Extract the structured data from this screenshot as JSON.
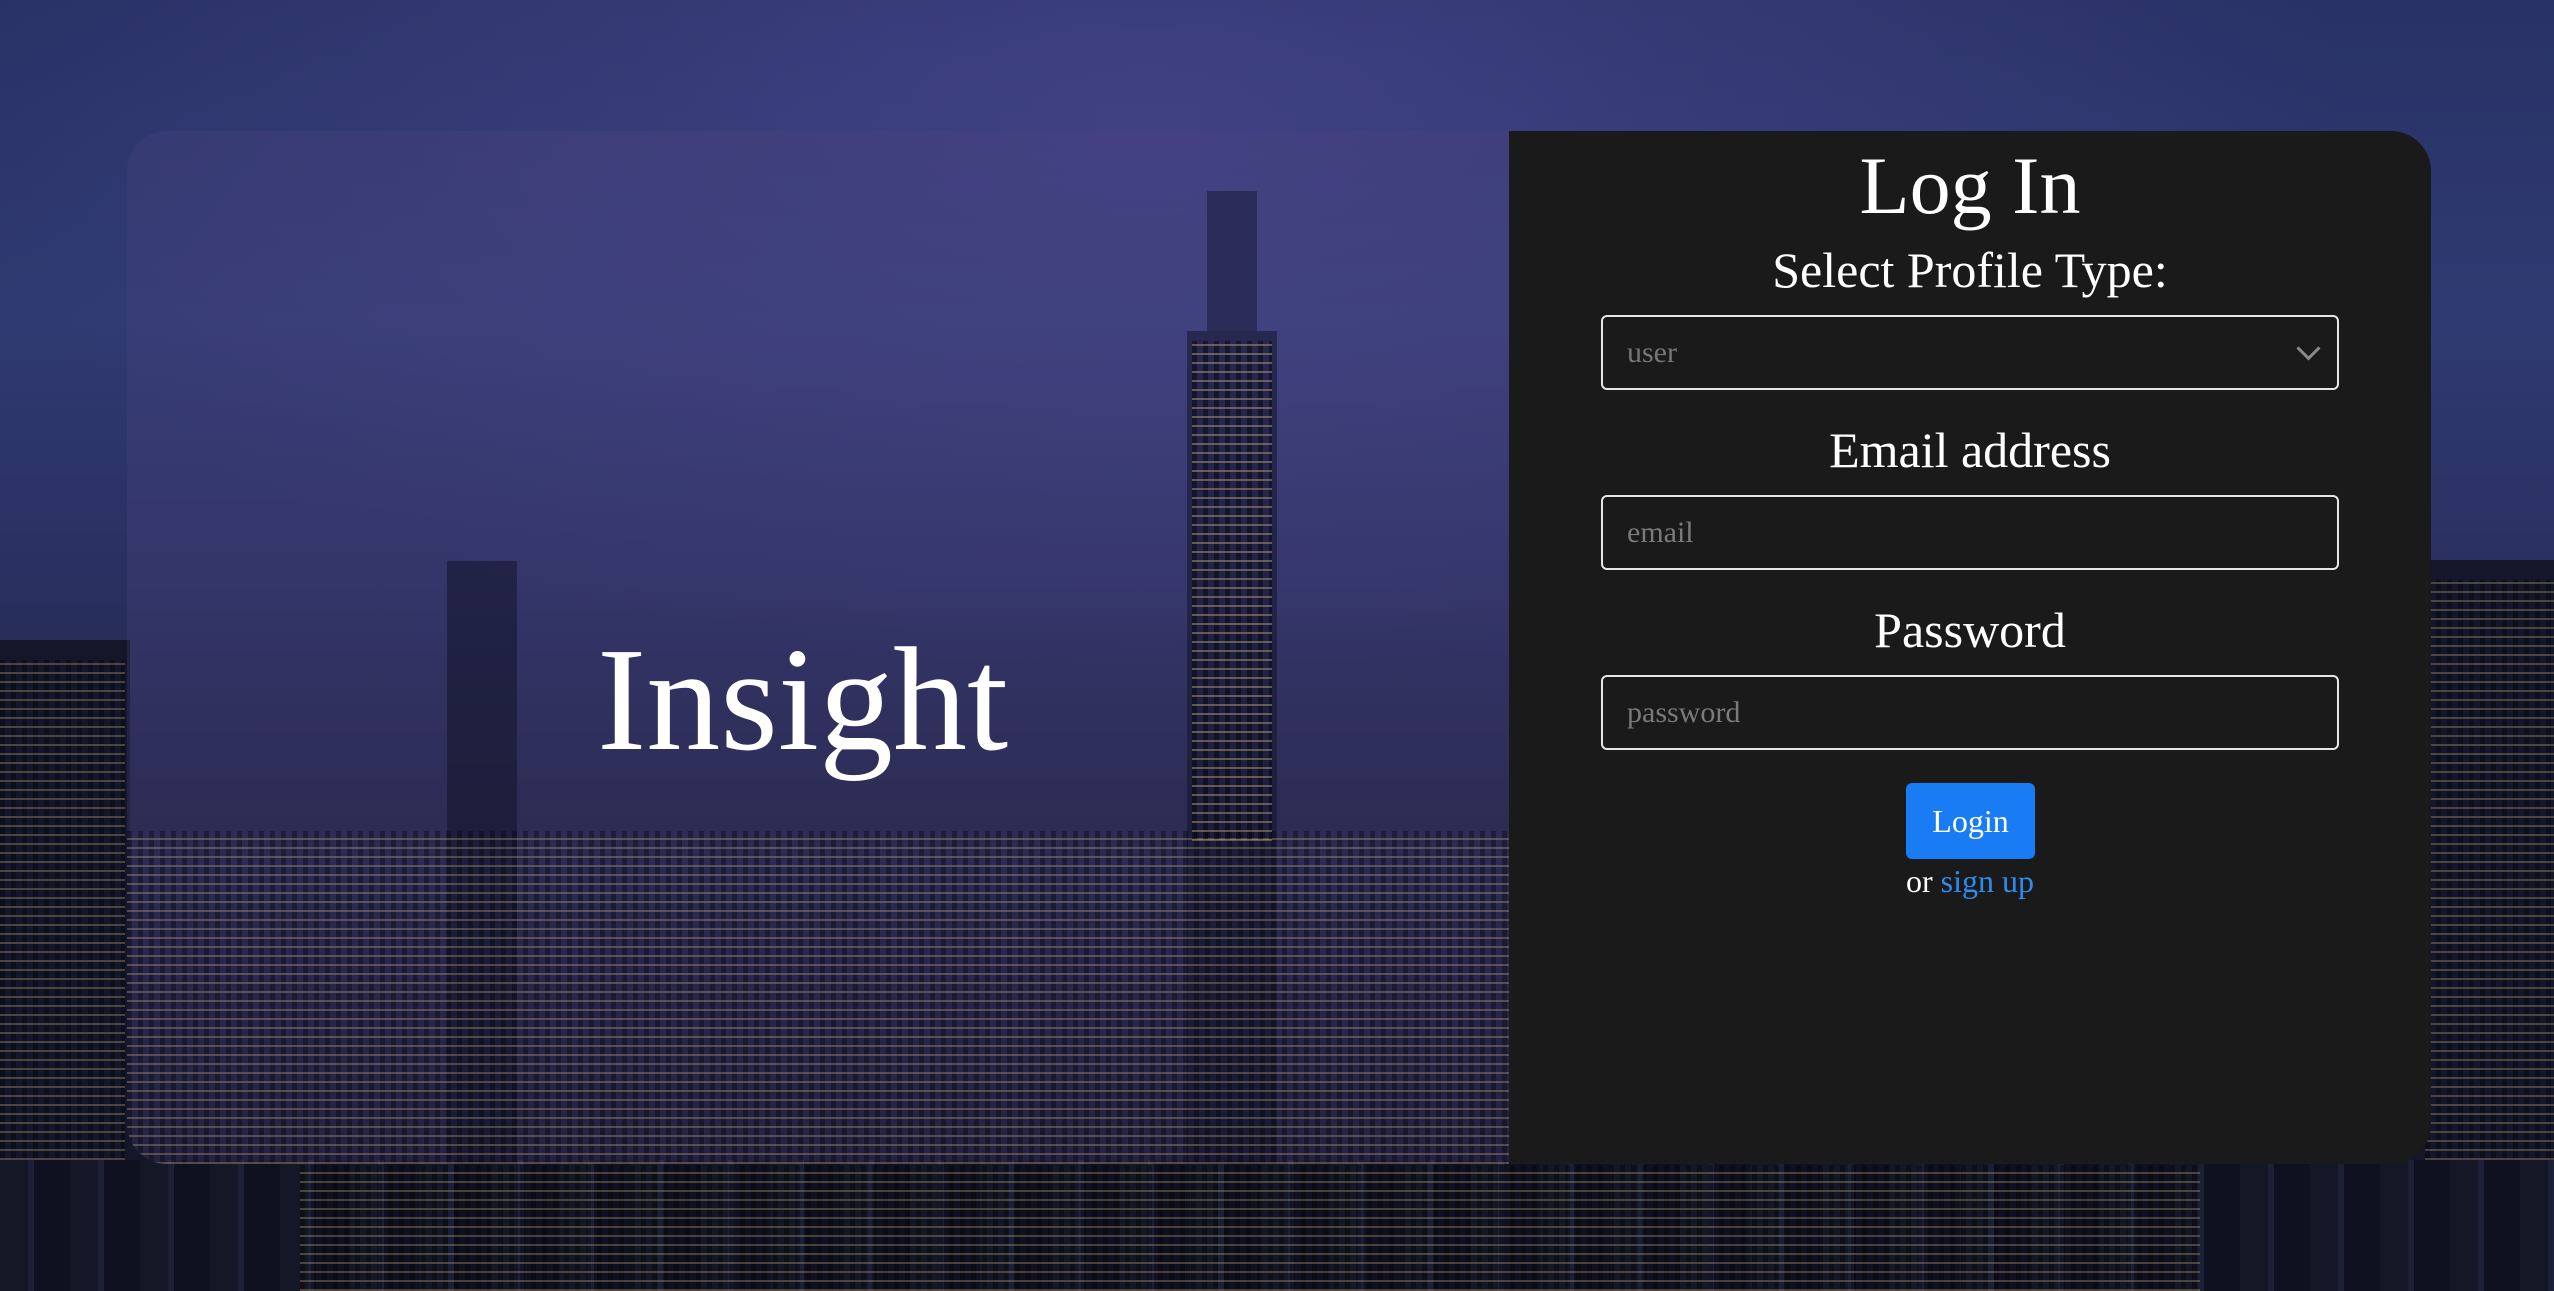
{
  "brand": {
    "name": "Insight"
  },
  "login_form": {
    "title": "Log In",
    "profile_type_label": "Select Profile Type:",
    "profile_type_value": "user",
    "email_label": "Email address",
    "email_placeholder": "email",
    "password_label": "Password",
    "password_placeholder": "password",
    "login_button": "Login",
    "signup_prefix": "or",
    "signup_link": "sign up"
  },
  "colors": {
    "panel_background": "#1a1a1a",
    "primary_button": "#1a7cf5",
    "link": "#2e8bf0"
  }
}
